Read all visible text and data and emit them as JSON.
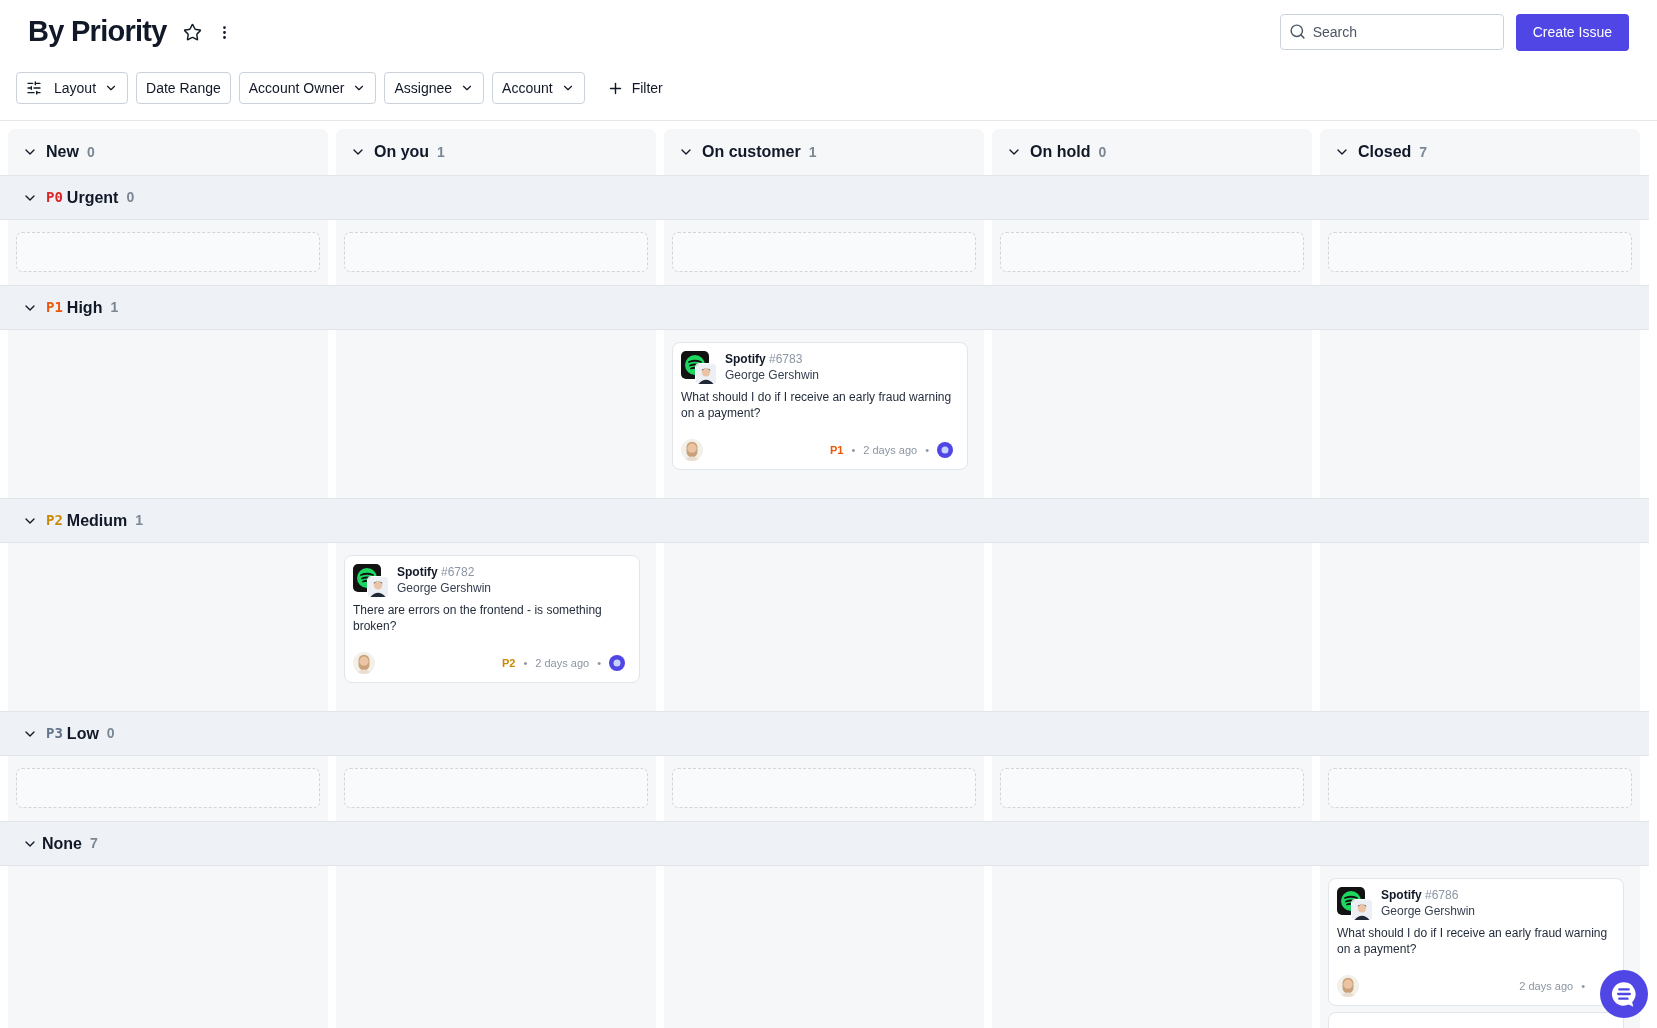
{
  "page": {
    "title": "By Priority",
    "search": {
      "placeholder": "Search"
    },
    "create_button": "Create Issue"
  },
  "filters": [
    {
      "label": "Layout",
      "kind": "layout"
    },
    {
      "label": "Date Range",
      "kind": "plain"
    },
    {
      "label": "Account Owner",
      "kind": "dropdown"
    },
    {
      "label": "Assignee",
      "kind": "dropdown"
    },
    {
      "label": "Account",
      "kind": "dropdown"
    },
    {
      "label": "Filter",
      "kind": "add"
    }
  ],
  "columns": [
    {
      "name": "New",
      "count": "0"
    },
    {
      "name": "On you",
      "count": "1"
    },
    {
      "name": "On customer",
      "count": "1"
    },
    {
      "name": "On hold",
      "count": "0"
    },
    {
      "name": "Closed",
      "count": "7"
    }
  ],
  "groups": [
    {
      "code": "P0",
      "color": "#dc2626",
      "name": "Urgent",
      "count": "0",
      "kind": "empty",
      "cells": [
        [],
        [],
        [],
        [],
        []
      ]
    },
    {
      "code": "P1",
      "color": "#ea580c",
      "name": "High",
      "count": "1",
      "kind": "filled",
      "cells": [
        [],
        [],
        [
          {
            "account": "Spotify",
            "number": "#6783",
            "contact": "George Gershwin",
            "text": "What should I do if I receive an early fraud warning on a payment?",
            "footer": [
              {
                "kind": "priority",
                "text": "P1"
              },
              {
                "kind": "separator",
                "text": "•"
              },
              {
                "kind": "time",
                "text": "2 days ago"
              },
              {
                "kind": "separator",
                "text": "•"
              }
            ],
            "status_icon": true
          }
        ],
        [],
        []
      ]
    },
    {
      "code": "P2",
      "color": "#ca8a04",
      "name": "Medium",
      "count": "1",
      "kind": "filled",
      "cells": [
        [],
        [
          {
            "account": "Spotify",
            "number": "#6782",
            "contact": "George Gershwin",
            "text": "There are errors on the frontend - is something broken?",
            "footer": [
              {
                "kind": "priority",
                "text": "P2"
              },
              {
                "kind": "separator",
                "text": "•"
              },
              {
                "kind": "time",
                "text": "2 days ago"
              },
              {
                "kind": "separator",
                "text": "•"
              }
            ],
            "status_icon": true
          }
        ],
        [],
        [],
        []
      ]
    },
    {
      "code": "P3",
      "color": "#64748b",
      "name": "Low",
      "count": "0",
      "kind": "empty",
      "cells": [
        [],
        [],
        [],
        [],
        []
      ]
    },
    {
      "name": "None",
      "count": "7",
      "kind": "filled",
      "cells": [
        [],
        [],
        [],
        [],
        [
          {
            "account": "Spotify",
            "number": "#6786",
            "contact": "George Gershwin",
            "text": "What should I do if I receive an early fraud warning on a payment?",
            "footer": [
              {
                "kind": "time",
                "text": "2 days ago"
              },
              {
                "kind": "separator",
                "text": "•"
              }
            ],
            "status_icon": false
          }
        ]
      ]
    }
  ]
}
